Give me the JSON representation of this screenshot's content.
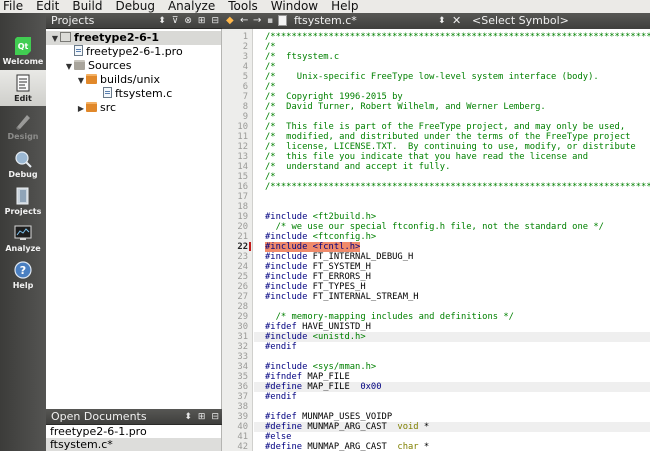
{
  "menu": [
    "File",
    "Edit",
    "Build",
    "Debug",
    "Analyze",
    "Tools",
    "Window",
    "Help"
  ],
  "modes": [
    {
      "label": "Welcome",
      "icon": "qt-logo-icon",
      "state": "normal"
    },
    {
      "label": "Edit",
      "icon": "edit-document-icon",
      "state": "active"
    },
    {
      "label": "Design",
      "icon": "design-pen-icon",
      "state": "disabled"
    },
    {
      "label": "Debug",
      "icon": "debug-bug-icon",
      "state": "normal"
    },
    {
      "label": "Projects",
      "icon": "projects-icon",
      "state": "normal"
    },
    {
      "label": "Analyze",
      "icon": "analyze-monitor-icon",
      "state": "normal"
    },
    {
      "label": "Help",
      "icon": "help-icon",
      "state": "normal"
    }
  ],
  "projects_panel": {
    "title": "Projects",
    "tree": [
      {
        "label": "freetype2-6-1",
        "depth": 0,
        "kind": "project",
        "expanded": true,
        "selected": true
      },
      {
        "label": "freetype2-6-1.pro",
        "depth": 1,
        "kind": "file"
      },
      {
        "label": "Sources",
        "depth": 1,
        "kind": "folder-gray",
        "expanded": true
      },
      {
        "label": "builds/unix",
        "depth": 2,
        "kind": "folder",
        "expanded": true
      },
      {
        "label": "ftsystem.c",
        "depth": 3,
        "kind": "file"
      },
      {
        "label": "src",
        "depth": 2,
        "kind": "folder",
        "expanded": false
      }
    ]
  },
  "open_documents": {
    "title": "Open Documents",
    "items": [
      {
        "label": "freetype2-6-1.pro",
        "selected": false
      },
      {
        "label": "ftsystem.c*",
        "selected": true
      }
    ]
  },
  "editor_bar": {
    "file_name": "ftsystem.c*",
    "symbol_placeholder": "<Select Symbol>"
  },
  "editor": {
    "current_line": 22,
    "lines": [
      {
        "n": 1,
        "segs": [
          [
            "comment",
            "/***************************************************************************"
          ]
        ]
      },
      {
        "n": 2,
        "segs": [
          [
            "comment",
            "/*"
          ]
        ]
      },
      {
        "n": 3,
        "segs": [
          [
            "comment",
            "/*  ftsystem.c"
          ]
        ]
      },
      {
        "n": 4,
        "segs": [
          [
            "comment",
            "/*"
          ]
        ]
      },
      {
        "n": 5,
        "segs": [
          [
            "comment",
            "/*    Unix-specific FreeType low-level system interface (body)."
          ]
        ]
      },
      {
        "n": 6,
        "segs": [
          [
            "comment",
            "/*"
          ]
        ]
      },
      {
        "n": 7,
        "segs": [
          [
            "comment",
            "/*  Copyright 1996-2015 by"
          ]
        ]
      },
      {
        "n": 8,
        "segs": [
          [
            "comment",
            "/*  David Turner, Robert Wilhelm, and Werner Lemberg."
          ]
        ]
      },
      {
        "n": 9,
        "segs": [
          [
            "comment",
            "/*"
          ]
        ]
      },
      {
        "n": 10,
        "segs": [
          [
            "comment",
            "/*  This file is part of the FreeType project, and may only be used,"
          ]
        ]
      },
      {
        "n": 11,
        "segs": [
          [
            "comment",
            "/*  modified, and distributed under the terms of the FreeType project"
          ]
        ]
      },
      {
        "n": 12,
        "segs": [
          [
            "comment",
            "/*  license, LICENSE.TXT.  By continuing to use, modify, or distribute"
          ]
        ]
      },
      {
        "n": 13,
        "segs": [
          [
            "comment",
            "/*  this file you indicate that you have read the license and"
          ]
        ]
      },
      {
        "n": 14,
        "segs": [
          [
            "comment",
            "/*  understand and accept it fully."
          ]
        ]
      },
      {
        "n": 15,
        "segs": [
          [
            "comment",
            "/*"
          ]
        ]
      },
      {
        "n": 16,
        "segs": [
          [
            "comment",
            "/***************************************************************************"
          ]
        ]
      },
      {
        "n": 17,
        "segs": []
      },
      {
        "n": 18,
        "segs": []
      },
      {
        "n": 19,
        "segs": [
          [
            "pp",
            "#include "
          ],
          [
            "str",
            "<ft2build.h>"
          ]
        ]
      },
      {
        "n": 20,
        "segs": [
          [
            "comment",
            "  /* we use our special ftconfig.h file, not the standard one */"
          ]
        ]
      },
      {
        "n": 21,
        "segs": [
          [
            "pp",
            "#include "
          ],
          [
            "str",
            "<ftconfig.h>"
          ]
        ]
      },
      {
        "n": 22,
        "segs": [
          [
            "warn",
            "#include <fcntl.h>"
          ]
        ]
      },
      {
        "n": 23,
        "segs": [
          [
            "pp",
            "#include "
          ],
          [
            "plain",
            "FT_INTERNAL_DEBUG_H"
          ]
        ]
      },
      {
        "n": 24,
        "segs": [
          [
            "pp",
            "#include "
          ],
          [
            "plain",
            "FT_SYSTEM_H"
          ]
        ]
      },
      {
        "n": 25,
        "segs": [
          [
            "pp",
            "#include "
          ],
          [
            "plain",
            "FT_ERRORS_H"
          ]
        ]
      },
      {
        "n": 26,
        "segs": [
          [
            "pp",
            "#include "
          ],
          [
            "plain",
            "FT_TYPES_H"
          ]
        ]
      },
      {
        "n": 27,
        "segs": [
          [
            "pp",
            "#include "
          ],
          [
            "plain",
            "FT_INTERNAL_STREAM_H"
          ]
        ]
      },
      {
        "n": 28,
        "segs": []
      },
      {
        "n": 29,
        "segs": [
          [
            "comment",
            "  /* memory-mapping includes and definitions */"
          ]
        ]
      },
      {
        "n": 30,
        "segs": [
          [
            "pp",
            "#ifdef "
          ],
          [
            "plain",
            "HAVE_UNISTD_H"
          ]
        ]
      },
      {
        "n": 31,
        "segs": [
          [
            "pp",
            "#include "
          ],
          [
            "str",
            "<unistd.h>"
          ]
        ],
        "hl": true
      },
      {
        "n": 32,
        "segs": [
          [
            "pp",
            "#endif"
          ]
        ]
      },
      {
        "n": 33,
        "segs": []
      },
      {
        "n": 34,
        "segs": [
          [
            "pp",
            "#include "
          ],
          [
            "str",
            "<sys/mman.h>"
          ]
        ]
      },
      {
        "n": 35,
        "segs": [
          [
            "pp",
            "#ifndef "
          ],
          [
            "plain",
            "MAP_FILE"
          ]
        ]
      },
      {
        "n": 36,
        "segs": [
          [
            "pp",
            "#define "
          ],
          [
            "plain",
            "MAP_FILE  "
          ],
          [
            "num",
            "0x00"
          ]
        ],
        "hl": true
      },
      {
        "n": 37,
        "segs": [
          [
            "pp",
            "#endif"
          ]
        ]
      },
      {
        "n": 38,
        "segs": []
      },
      {
        "n": 39,
        "segs": [
          [
            "pp",
            "#ifdef "
          ],
          [
            "plain",
            "MUNMAP_USES_VOIDP"
          ]
        ]
      },
      {
        "n": 40,
        "segs": [
          [
            "pp",
            "#define "
          ],
          [
            "plain",
            "MUNMAP_ARG_CAST  "
          ],
          [
            "kw",
            "void"
          ],
          [
            "plain",
            " *"
          ]
        ],
        "hl": true
      },
      {
        "n": 41,
        "segs": [
          [
            "pp",
            "#else"
          ]
        ]
      },
      {
        "n": 42,
        "segs": [
          [
            "pp",
            "#define "
          ],
          [
            "plain",
            "MUNMAP_ARG_CAST  "
          ],
          [
            "kw",
            "char"
          ],
          [
            "plain",
            " *"
          ]
        ]
      }
    ]
  }
}
